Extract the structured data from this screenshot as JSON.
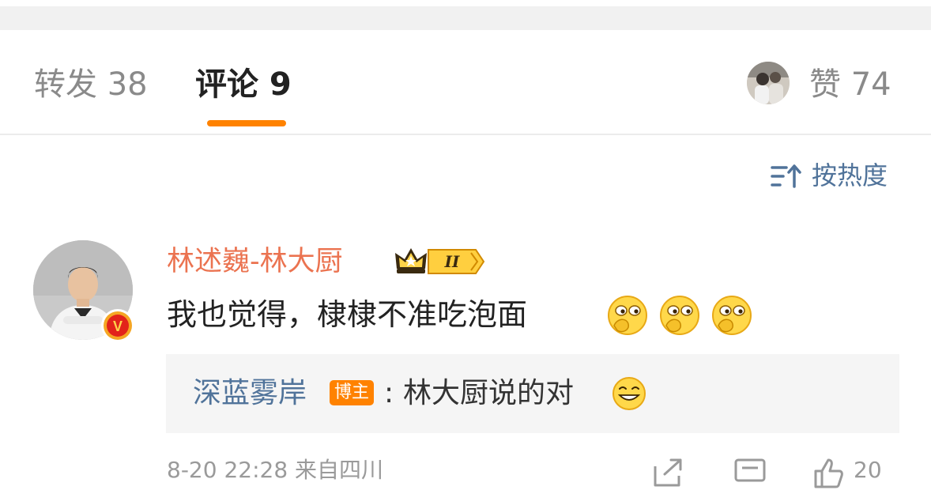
{
  "tabs": {
    "repost_label": "转发 38",
    "comment_label": "评论 9",
    "likes_label": "赞 74"
  },
  "sort": {
    "label": "按热度",
    "icon": "sort-icon"
  },
  "comment": {
    "username": "林述巍-林大厨",
    "badge_level": "II",
    "text": "我也觉得，棣棣不准吃泡面",
    "emojis": [
      "thinking-face-emoji",
      "thinking-face-emoji",
      "thinking-face-emoji"
    ],
    "verified_badge": "V",
    "reply": {
      "username": "深蓝雾岸",
      "author_tag": "博主",
      "separator": ":",
      "text": "林大厨说的对",
      "emoji": "grin-face-emoji"
    },
    "meta": "8-20 22:28 来自四川",
    "like_count": "20"
  },
  "colors": {
    "accent": "#ff8200",
    "username": "#eb7350",
    "link": "#50739a",
    "muted": "#8a8a8a"
  }
}
